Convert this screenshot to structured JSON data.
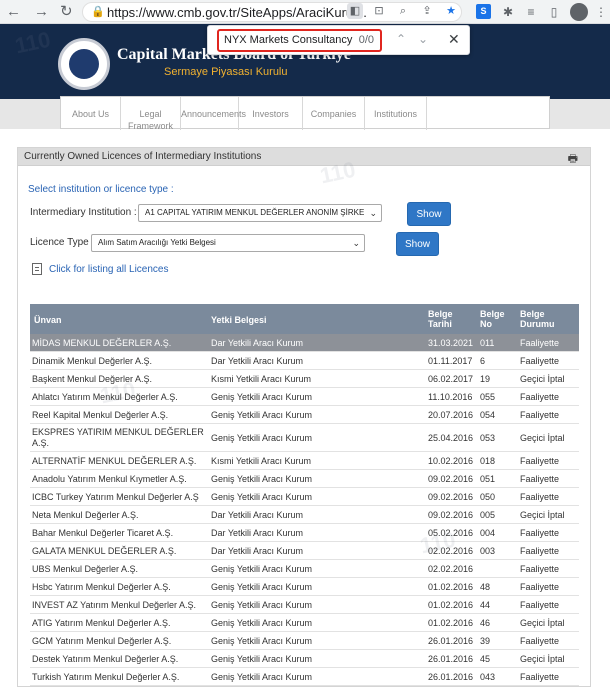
{
  "browser": {
    "url": "https://www.cmb.gov.tr/SiteApps/AraciKurul..."
  },
  "find_bar": {
    "query": "NYX Markets Consultancy",
    "count": "0/0"
  },
  "header": {
    "org_name": "Capital Markets Board of Turkiye",
    "org_sub": "Sermaye Piyasası Kurulu"
  },
  "nav": [
    {
      "label": "About Us"
    },
    {
      "label": "Legal Framework"
    },
    {
      "label": "Announcements"
    },
    {
      "label": "Investors"
    },
    {
      "label": "Companies"
    },
    {
      "label": "Institutions"
    }
  ],
  "panel": {
    "title": "Currently Owned Licences of Intermediary Institutions",
    "select_prompt": "Select institution or licence type :",
    "institution_label": "Intermediary Institution :",
    "institution_value": "A1 CAPITAL YATIRIM MENKUL DEĞERLER ANONİM ŞİRKE",
    "licence_label": "Licence Type :",
    "licence_value": "Alım Satım Aracılığı Yetki Belgesi",
    "show_label": "Show",
    "list_link": "Click for listing all Licences"
  },
  "table": {
    "headers": {
      "unvan": "Ünvan",
      "yetki": "Yetki Belgesi",
      "tarih": "Belge Tarihi",
      "no": "Belge No",
      "durum": "Belge Durumu"
    },
    "rows": [
      {
        "unvan": "MİDAS MENKUL DEĞERLER A.Ş.",
        "yetki": "Dar Yetkili Aracı Kurum",
        "tarih": "31.03.2021",
        "no": "011",
        "durum": "Faaliyette"
      },
      {
        "unvan": "Dinamik Menkul Değerler A.Ş.",
        "yetki": "Dar Yetkili Aracı Kurum",
        "tarih": "01.11.2017",
        "no": "6",
        "durum": "Faaliyette"
      },
      {
        "unvan": "Başkent Menkul Değerler A.Ş.",
        "yetki": "Kısmi Yetkili Aracı Kurum",
        "tarih": "06.02.2017",
        "no": "19",
        "durum": "Geçici İptal"
      },
      {
        "unvan": "Ahlatcı Yatırım Menkul Değerler A.Ş.",
        "yetki": "Geniş Yetkili Aracı Kurum",
        "tarih": "11.10.2016",
        "no": "055",
        "durum": "Faaliyette"
      },
      {
        "unvan": "Reel Kapital Menkul Değerler A.Ş.",
        "yetki": "Geniş Yetkili Aracı Kurum",
        "tarih": "20.07.2016",
        "no": "054",
        "durum": "Faaliyette"
      },
      {
        "unvan": "EKSPRES YATIRIM MENKUL DEĞERLER A.Ş.",
        "yetki": "Geniş Yetkili Aracı Kurum",
        "tarih": "25.04.2016",
        "no": "053",
        "durum": "Geçici İptal"
      },
      {
        "unvan": "ALTERNATİF MENKUL DEĞERLER A.Ş.",
        "yetki": "Kısmi Yetkili Aracı Kurum",
        "tarih": "10.02.2016",
        "no": "018",
        "durum": "Faaliyette"
      },
      {
        "unvan": "Anadolu Yatırım Menkul Kıymetler A.Ş.",
        "yetki": "Geniş Yetkili Aracı Kurum",
        "tarih": "09.02.2016",
        "no": "051",
        "durum": "Faaliyette"
      },
      {
        "unvan": "ICBC Turkey Yatırım Menkul Değerler A.Ş",
        "yetki": "Geniş Yetkili Aracı Kurum",
        "tarih": "09.02.2016",
        "no": "050",
        "durum": "Faaliyette"
      },
      {
        "unvan": "Neta Menkul Değerler A.Ş.",
        "yetki": "Dar Yetkili Aracı Kurum",
        "tarih": "09.02.2016",
        "no": "005",
        "durum": "Geçici İptal"
      },
      {
        "unvan": "Bahar Menkul Değerler Ticaret A.Ş.",
        "yetki": "Dar Yetkili Aracı Kurum",
        "tarih": "05.02.2016",
        "no": "004",
        "durum": "Faaliyette"
      },
      {
        "unvan": "GALATA MENKUL DEĞERLER A.Ş.",
        "yetki": "Dar Yetkili Aracı Kurum",
        "tarih": "02.02.2016",
        "no": "003",
        "durum": "Faaliyette"
      },
      {
        "unvan": "UBS Menkul Değerler A.Ş.",
        "yetki": "Geniş Yetkili Aracı Kurum",
        "tarih": "02.02.2016",
        "no": "",
        "durum": "Faaliyette"
      },
      {
        "unvan": "Hsbc Yatırım Menkul Değerler A.Ş.",
        "yetki": "Geniş Yetkili Aracı Kurum",
        "tarih": "01.02.2016",
        "no": "48",
        "durum": "Faaliyette"
      },
      {
        "unvan": "INVEST AZ Yatırım Menkul Değerler A.Ş.",
        "yetki": "Geniş Yetkili Aracı Kurum",
        "tarih": "01.02.2016",
        "no": "44",
        "durum": "Faaliyette"
      },
      {
        "unvan": "ATIG Yatırım Menkul Değerler A.Ş.",
        "yetki": "Geniş Yetkili Aracı Kurum",
        "tarih": "01.02.2016",
        "no": "46",
        "durum": "Geçici İptal"
      },
      {
        "unvan": "GCM Yatırım Menkul Değerler A.Ş.",
        "yetki": "Geniş Yetkili Aracı Kurum",
        "tarih": "26.01.2016",
        "no": "39",
        "durum": "Faaliyette"
      },
      {
        "unvan": "Destek Yatırım Menkul Değerler A.Ş.",
        "yetki": "Geniş Yetkili Aracı Kurum",
        "tarih": "26.01.2016",
        "no": "45",
        "durum": "Geçici İptal"
      },
      {
        "unvan": "Turkish Yatırım Menkul Değerler A.Ş.",
        "yetki": "Geniş Yetkili Aracı Kurum",
        "tarih": "26.01.2016",
        "no": "043",
        "durum": "Faaliyette"
      }
    ]
  }
}
